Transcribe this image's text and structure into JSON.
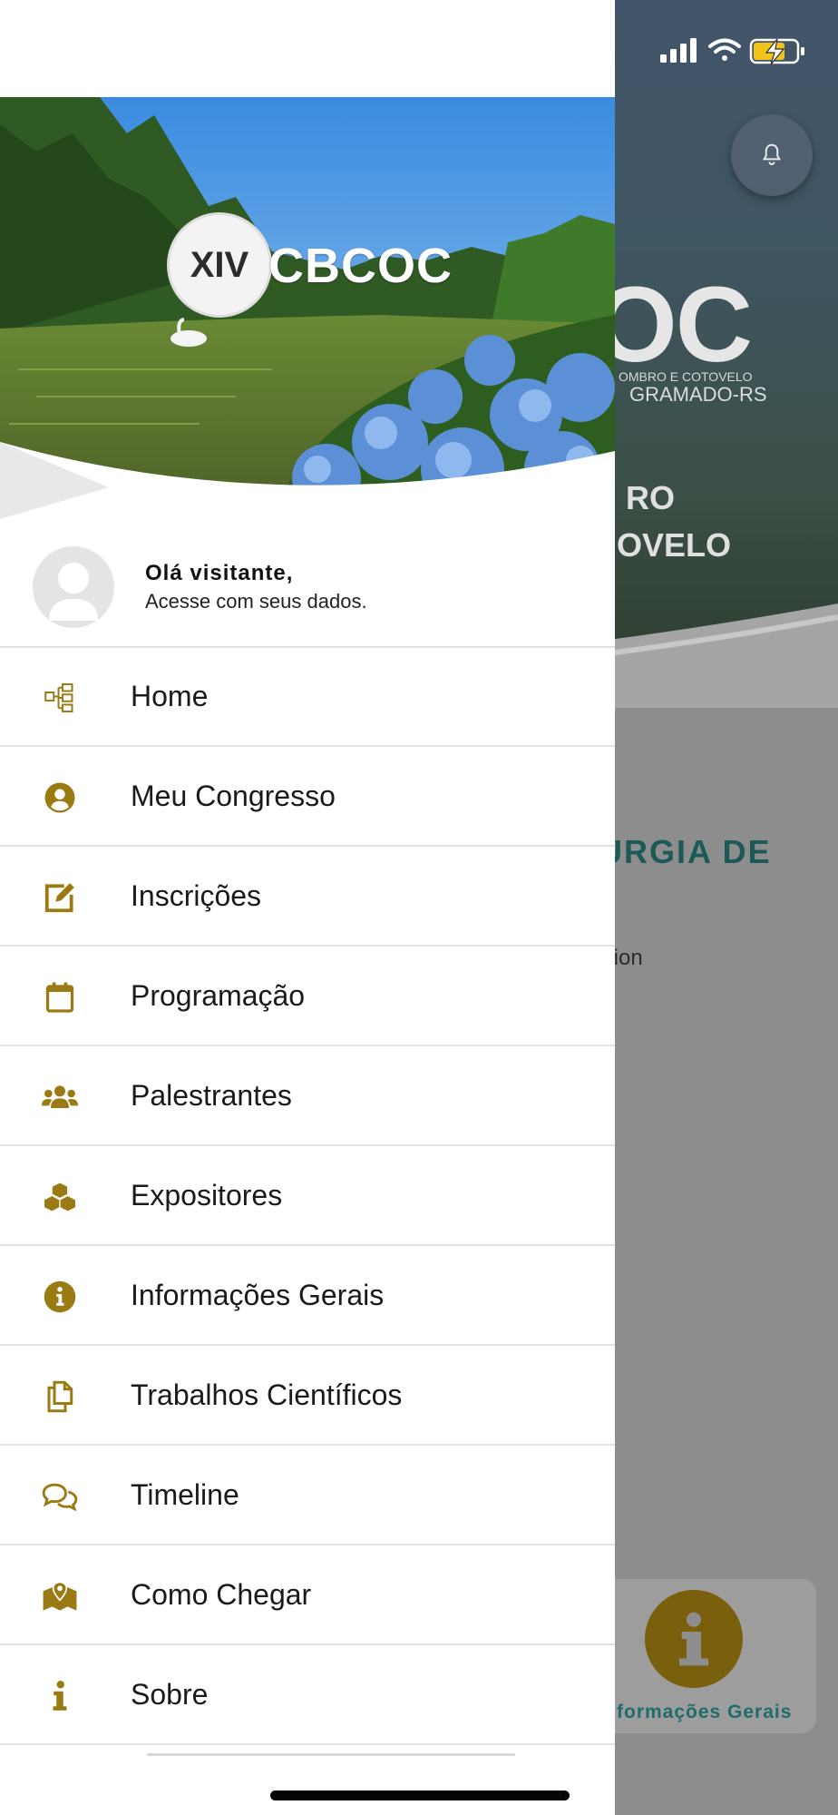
{
  "background": {
    "logo_text": "OC",
    "logo_sub1": "OMBRO E COTOVELO",
    "logo_sub2": "GRAMADO-RS",
    "hero_line1": "RO",
    "hero_line2": "OVELO",
    "section_title": "URGIA DE",
    "section_sub": "tion",
    "card_label": "formações Gerais",
    "bell_icon": "bell-icon",
    "card_icon": "info-icon"
  },
  "drawer": {
    "logo": {
      "badge": "XIV",
      "name": "CBCOC"
    },
    "profile": {
      "greeting": "Olá visitante,",
      "subtitle": "Acesse com seus dados."
    },
    "menu": [
      {
        "label": "Home",
        "icon": "home-modules-icon"
      },
      {
        "label": "Meu Congresso",
        "icon": "user-circle-icon"
      },
      {
        "label": "Inscrições",
        "icon": "edit-icon"
      },
      {
        "label": "Programação",
        "icon": "calendar-icon"
      },
      {
        "label": "Palestrantes",
        "icon": "users-icon"
      },
      {
        "label": "Expositores",
        "icon": "cubes-icon"
      },
      {
        "label": "Informações Gerais",
        "icon": "info-circle-icon"
      },
      {
        "label": "Trabalhos Científicos",
        "icon": "copy-icon"
      },
      {
        "label": "Timeline",
        "icon": "comments-icon"
      },
      {
        "label": "Como Chegar",
        "icon": "map-marker-icon"
      },
      {
        "label": "Sobre",
        "icon": "info-icon"
      }
    ]
  },
  "colors": {
    "accent": "#9a7a12",
    "teal": "#1d5a57"
  }
}
